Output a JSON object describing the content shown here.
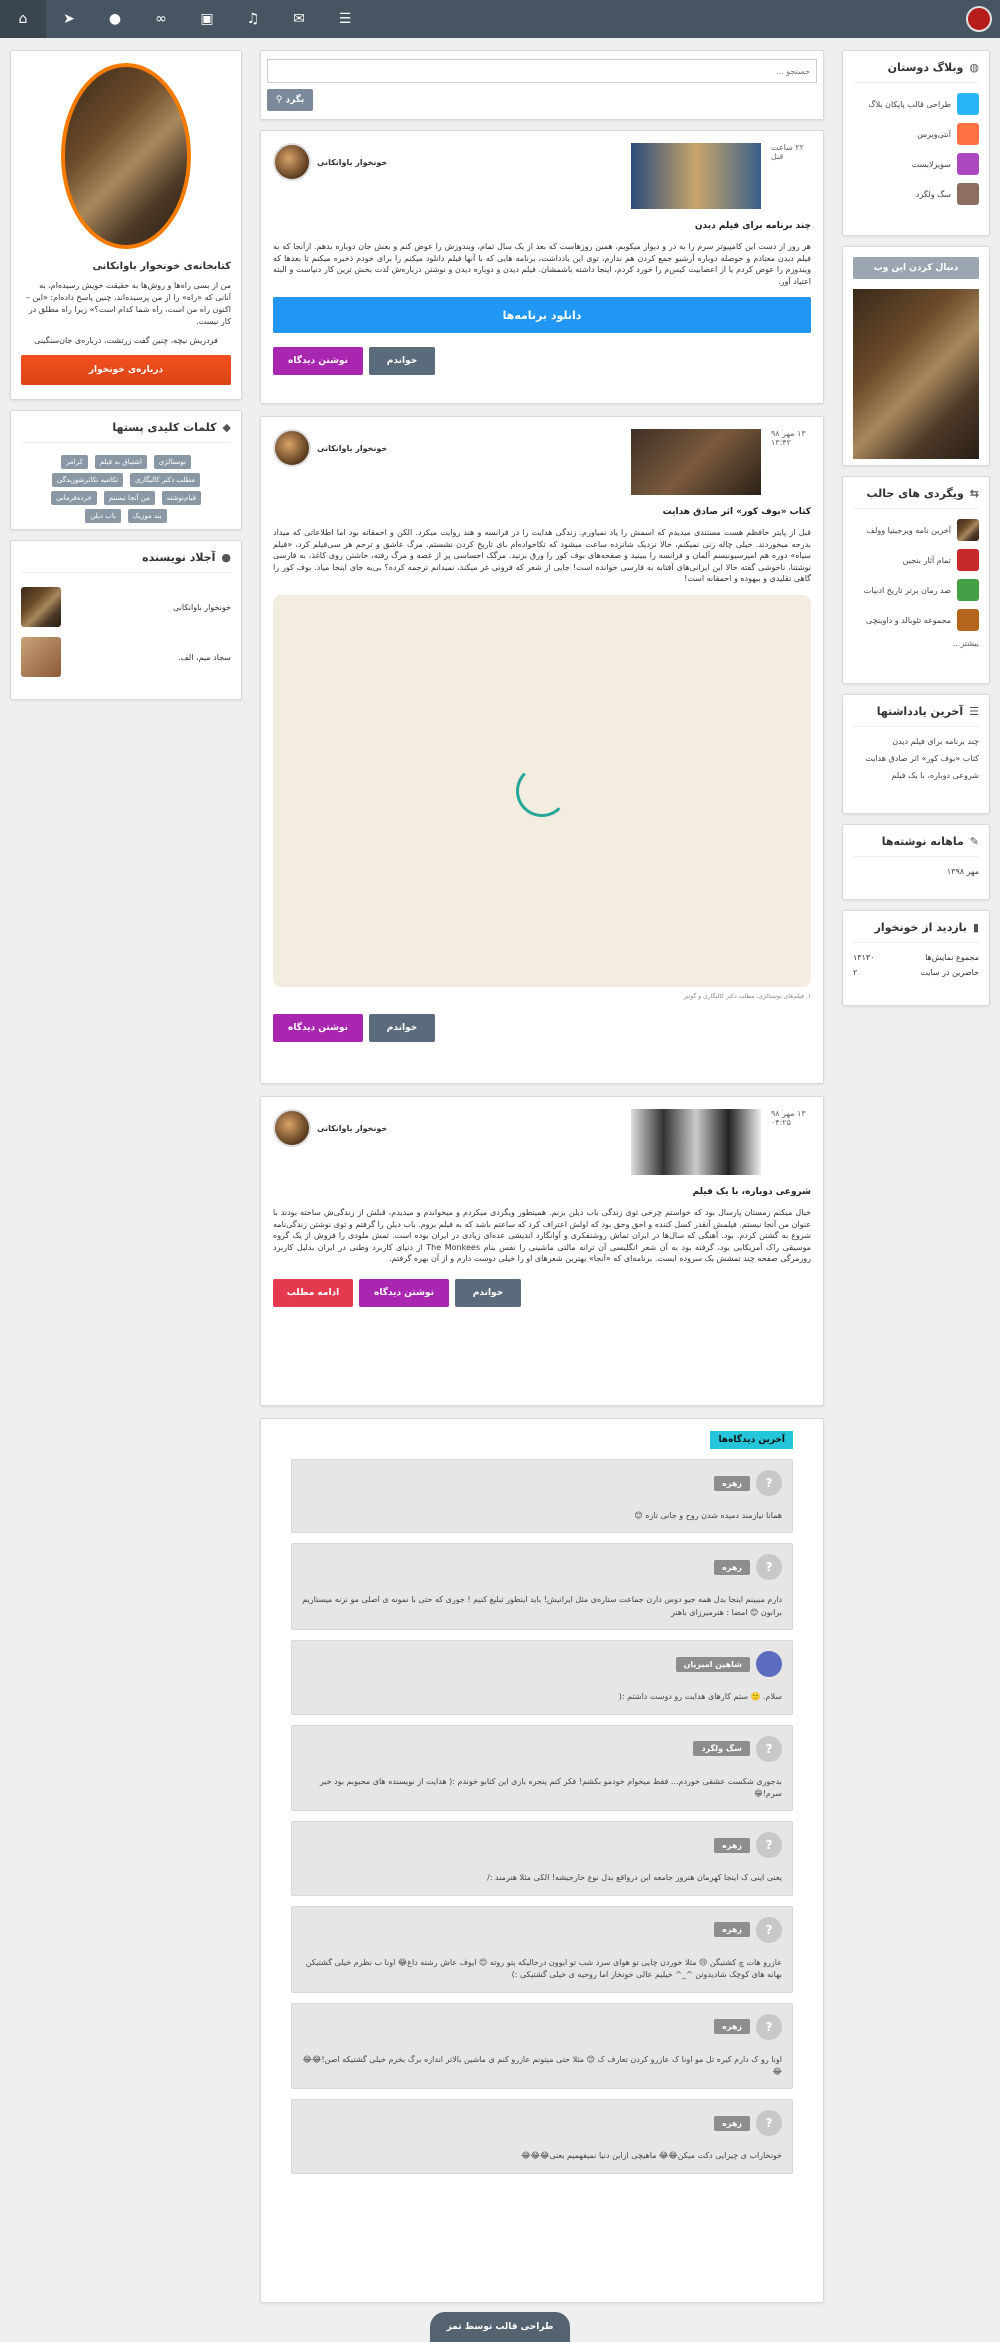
{
  "nav": {
    "icons": [
      "home-icon",
      "send-icon",
      "user-icon",
      "link-icon",
      "film-icon",
      "music-icon",
      "mail-icon",
      "menu-icon"
    ]
  },
  "search": {
    "placeholder": "جستجو ...",
    "button": "بگرد"
  },
  "right": {
    "friends": {
      "title": "وبلاگ دوستان",
      "items": [
        "طراحی قالب پاپکان بلاگ",
        "آنتی‌ویرس",
        "سوپرلایست",
        "سگ ولگرد"
      ]
    },
    "follow": {
      "label": "دنبال کردن این وب"
    },
    "features": {
      "title": "ویگردی های جالب",
      "items": [
        "آخرین نامه ویرجینیا وولف",
        "تمام آثار بنجین",
        "صد رمان برتر تاریخ ادبیات",
        "مجموعه تئوبالد و داوینچی"
      ],
      "more": "بیشتر..."
    },
    "recent": {
      "title": "آخرین یادداشتها",
      "items": [
        "چند برنامه برای فیلم دیدن",
        "کتاب «بوف کور» اثر صادق هدایت",
        "شروعی دوباره، با یک فیلم"
      ]
    },
    "archive": {
      "title": "ماهانه نوشته‌ها",
      "items": [
        "مهر ۱۳۹۸"
      ]
    },
    "stats": {
      "title": "بازدید از خونخوار",
      "rows": [
        {
          "label": "مجموع نمایش‌ها",
          "value": "۱۳۱۳۰"
        },
        {
          "label": "حاضرین در سایت",
          "value": "۲"
        }
      ]
    }
  },
  "left": {
    "library": {
      "title": "کتابخانه‌ی خونخوار باوانکانی",
      "text": "من از بسی راه‌ها و روش‌ها به حقیقت خویش رسیده‌ام، به آنانی که «راه» را از من پرسیده‌اند، چنین پاسخ داده‌ام: «این –اکنون راه من است، راه شما کدام است؟» زیرا راه مطلق در کار نیست.",
      "sign": "فردریش نیچه، چنین گفت زرتشت، درباره‌ی جان‌سنگینی",
      "button": "درباره‌ی خونخوار"
    },
    "tags": {
      "title": "کلمات کلیدی پستها",
      "items": [
        "نوستالژی",
        "اشتیاق به فیلم",
        "کرامر",
        "مطلب دکتر کالیگاری",
        "تکامیه تکاثرشوریدگی",
        "قیام‌نوشته",
        "من آنجا نیستم",
        "خرده‌فرمانی",
        "بند موزیک",
        "باب دیلن"
      ]
    },
    "authors": {
      "title": "آجلاد نویسنده",
      "items": [
        "خونخوار باوانکانی",
        "سجاد میم، الف."
      ]
    }
  },
  "posts": [
    {
      "date": "۲۲ ساعت قبل",
      "author": "خونخوار باوانکانی",
      "title": "چند برنامه برای فیلم دیدن",
      "body": "هر روز از دست این کامپیوتر سرم را به در و دیوار میکوبم، همین روزهاست که بعد از یک سال تمام، ویندوزش را عوض کنم و بعش جان دوباره بدهم. ازآنجا که به فیلم دیدن معتادم و حوصله دوباره آرشیو جمع کردن هم ندارم، توی این یادداشت، برنامه هایی که با آنها فیلم دانلود میکنم را برای خودم ذخیره میکنم تا بعدها که ویندوزم را عوض کردم یا از اعصابیت کیس‌م را خورد کردم، اینجا داشته باشمشان. فیلم دیدن و دوباره دیدن و نوشتن درباره‌ش لذت بخش ترین کار دنیاست و البته اعتیاد آور.",
      "download": "دانلود برنامه‌ها",
      "read": "خواندم",
      "comment": "نوشتن دیدگاه"
    },
    {
      "date": "۱۳ مهر ۹۸",
      "time": "۱۳:۴۲",
      "author": "خونخوار باوانکانی",
      "title": "کتاب «بوف کور» اثر صادق هدایت",
      "body": "قبل از پایتر حافظم هست مستندی میدیدم که اسمش را یاد نمیاورم. زندگی هدایت را در فرانسه و هند روایت میکرد. الکن و احمقانه بود اما اطلاعاتی که میداد بدرجه میخوردند. خیلی چاله زنی نمیکنم، حالا نزدیک شانزده ساعت میشود که تکاخواده‌ام بای تاریخ کردن نشستم. مرگ عاشق و ترحم هر سی‌فیلم کرد، «فیلم سیاه» دوره هم امپرسیونیسم آلمان و فرانسه را ببینید و صفحه‌های بوف کور را ورق بزنید. مرگک احساسی پر از غصه و مرگ رفته، حاشتن روی کاغذ، به فارسی نوشتنا، ناخوشی گفته حالا این ایرانی‌های آفتابه به فارسی خوانده است! جایی از شعر که فرونی غر میکند، نمیدانم ترجمه کرده؟ بی‌یه جای اینجا میاد. بوف کور را گاهی تقلیدی و بیهوده و احمقانه است!",
      "caption": "۱. فیلم‌های نوستالژی، مطلب دکتر کالیگاری و گوتیر",
      "read": "خواندم",
      "comment": "نوشتن دیدگاه"
    },
    {
      "date": "۱۳ مهر ۹۸",
      "time": "۰۴:۲۵",
      "author": "خونخوار باوانکانی",
      "title": "شروعی دوباره، با یک فیلم",
      "body": "خیال میکنم زمستان پارسال بود که خواستم چرخی توی زندگی باب دیلن بزنم. همینطور ویگردی میکردم و میخواندم و میدیدم، قبلش از زندگی‌ش ساخته بودند با عنوان من آنجا نیستم. فیلمش آنقدر کسل کننده و احق وحق بود که اولش اعتراف کرد که ساعتم باشد که به فیلم بروم. باب دیلن را گرفتم و توی نوشتن زندگی‌نامه شروع به گشتن کردم. بود. آهنگی که سال‌ها در ایران تماش روشنفکری و آوانگارد اندیشی عده‌ای زیادی در ایران بوده است. تمش ملودی را فروش از یک گروه موسیقی راک آمریکایی بود، گرفته بود به آن شعر انگلیسی آن ترانه مالتی ماشینی را نفس بنام The Monkees از دنیای کاربرد وطنی در ایران بدلیل کاربرد روزمرگی صفحه چند تمشش یک سروده ایست. برنامه‌ای که «آنجا» بهترین شعرهای او را خیلی دوست دارم و از آن بهره گرفتم.",
      "read": "خواندم",
      "comment": "نوشتن دیدگاه",
      "more": "ادامه مطلب"
    }
  ],
  "comments": {
    "title": "آخرین دیدگاه‌ها",
    "items": [
      {
        "name": "زهره",
        "text": "همانا نیازمند دمیده شدن روح و جانی تازه 😊"
      },
      {
        "name": "زهره",
        "text": "دارم میبینم اینجا بدل همه جیو دوس دارن جماعت ستاره‌ی مثل ایرانیش! باید اینطور تبلیغ کنیم ! جوری که حتی با نمونه ی اصلی مو نزنه میستاریم برانون 😊 امضا : هنرمیرزای باهنر"
      },
      {
        "name": "شاهین امیریان",
        "text": "سلام. 🙂 ستم کارهای هدایت رو دوست داشتم :("
      },
      {
        "name": "سگ ولگرد",
        "text": "بدجوری شکست عشقی خوردم... فقط میخوام خودمو بکشم! فکر کنم پنجره بازی این کتابو خوندم :( هدایت از نویسنده های محبوبم بود خیر سرم!😁"
      },
      {
        "name": "زهره",
        "text": "یعنی اینی ک اینجا کهرمان هنرور جامعه ابن درواقع بدل نوع خارجیشه! الکی مثلا هنرمند :/"
      },
      {
        "name": "زهره",
        "text": "عازرو هات چ کشتیگن 😢 مثلا خوردن چایی تو هوای سرد شب تو ایوون درحالیکه پتو روته 😊 ایوف عاش رشته داغ😂 اونا ب نظرم خیلی گشتیکن بهانه های کوچک شادیدوتن ^_^ خیلیم عالی خونخار اما روحیه ی خیلی گشتیکی :)"
      },
      {
        "name": "زهره",
        "text": "اونا رو ک دارم کیره تل مو اونا ک عازرو کردن تعارف ک 😊 مثلا حتی میتونم عازرو کنم ی ماشین بالاتر اندازه برگ بخرم خیلی گشتیکه اصن!😂😂😂"
      },
      {
        "name": "زهره",
        "text": "خونخاراب ی چیزایی دکت میکن😂😂 ماهیچی ازاین دنیا نمیفهمیم بعنی😂😂😂"
      }
    ]
  },
  "footer": {
    "label": "طراحی قالب توسط تمز"
  }
}
